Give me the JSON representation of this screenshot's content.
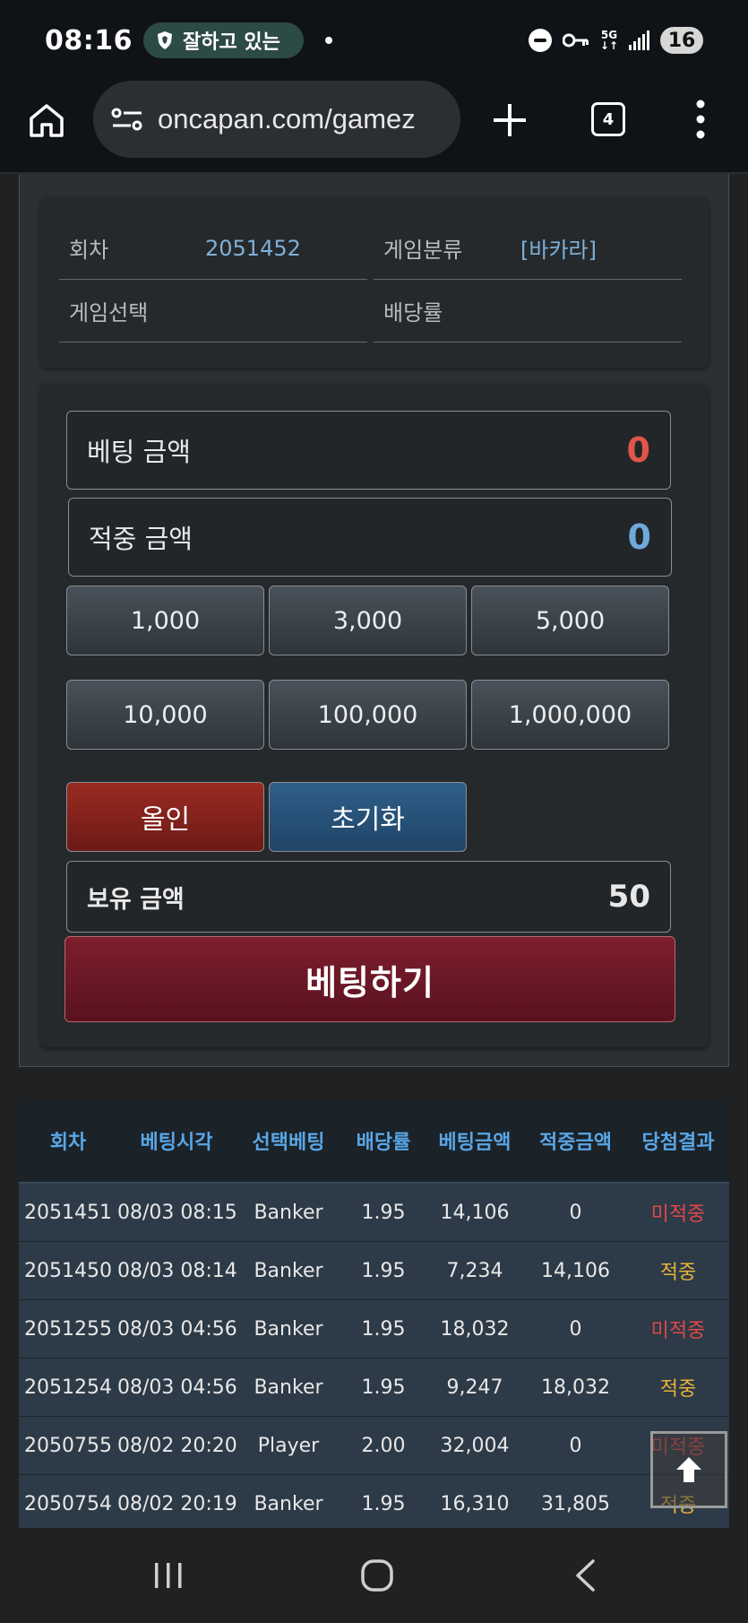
{
  "status_bar": {
    "time": "08:16",
    "notification": "잘하고 있는",
    "network": "5G",
    "battery": "16"
  },
  "browser": {
    "url": "oncapan.com/gamez",
    "tab_count": "4"
  },
  "game_info": {
    "round_label": "회차",
    "round_value": "2051452",
    "category_label": "게임분류",
    "category_value": "[바카라]",
    "selection_label": "게임선택",
    "selection_value": "",
    "odds_label": "배당률",
    "odds_value": ""
  },
  "bet_panel": {
    "bet_amount_label": "베팅 금액",
    "bet_amount_value": "0",
    "win_amount_label": "적중 금액",
    "win_amount_value": "0",
    "chips": [
      "1,000",
      "3,000",
      "5,000",
      "10,000",
      "100,000",
      "1,000,000"
    ],
    "all_in_label": "올인",
    "reset_label": "초기화",
    "balance_label": "보유 금액",
    "balance_value": "50",
    "submit_label": "베팅하기"
  },
  "history": {
    "columns": [
      "회차",
      "베팅시각",
      "선택베팅",
      "배당률",
      "베팅금액",
      "적중금액",
      "당첨결과"
    ],
    "rows": [
      [
        "2051451",
        "08/03 08:15",
        "Banker",
        "1.95",
        "14,106",
        "0",
        "미적중"
      ],
      [
        "2051450",
        "08/03 08:14",
        "Banker",
        "1.95",
        "7,234",
        "14,106",
        "적중"
      ],
      [
        "2051255",
        "08/03 04:56",
        "Banker",
        "1.95",
        "18,032",
        "0",
        "미적중"
      ],
      [
        "2051254",
        "08/03 04:56",
        "Banker",
        "1.95",
        "9,247",
        "18,032",
        "적중"
      ],
      [
        "2050755",
        "08/02 20:20",
        "Player",
        "2.00",
        "32,004",
        "0",
        "미적중"
      ],
      [
        "2050754",
        "08/02 20:19",
        "Banker",
        "1.95",
        "16,310",
        "31,805",
        "적중"
      ]
    ]
  },
  "colors": {
    "bet_amount": "#e0554a",
    "win_amount": "#6fa8dc",
    "miss": "#e04848",
    "hit": "#e8b23a"
  }
}
